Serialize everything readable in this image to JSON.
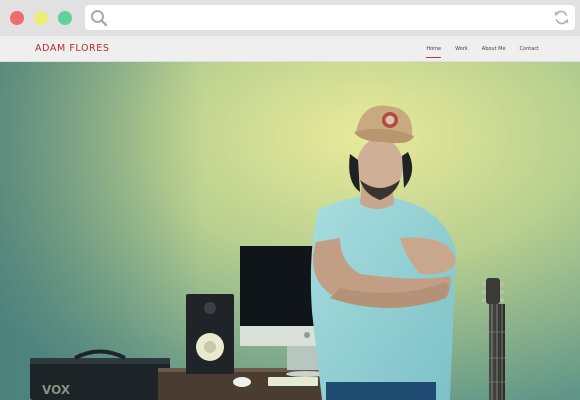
{
  "browser": {
    "window_controls": [
      "close",
      "minimize",
      "maximize"
    ],
    "address_bar_value": "",
    "icons": {
      "search": "search-icon",
      "reload": "reload-icon"
    }
  },
  "site": {
    "brand": "ADAM FLORES",
    "nav": [
      {
        "label": "Home",
        "active": true
      },
      {
        "label": "Work",
        "active": false
      },
      {
        "label": "About Me",
        "active": false
      },
      {
        "label": "Contact",
        "active": false
      }
    ],
    "accent_color": "#b52d2d"
  },
  "hero": {
    "amp_label": "VOX"
  }
}
